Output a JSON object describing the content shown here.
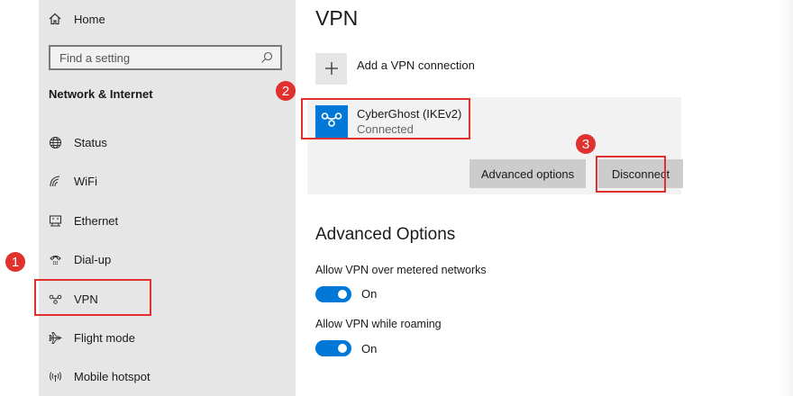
{
  "sidebar": {
    "home_label": "Home",
    "search_placeholder": "Find a setting",
    "section_title": "Network & Internet",
    "items": [
      {
        "label": "Status",
        "icon": "globe-icon"
      },
      {
        "label": "WiFi",
        "icon": "wifi-icon"
      },
      {
        "label": "Ethernet",
        "icon": "ethernet-icon"
      },
      {
        "label": "Dial-up",
        "icon": "dialup-icon"
      },
      {
        "label": "VPN",
        "icon": "vpn-icon"
      },
      {
        "label": "Flight mode",
        "icon": "airplane-icon"
      },
      {
        "label": "Mobile hotspot",
        "icon": "hotspot-icon"
      }
    ]
  },
  "main": {
    "title": "VPN",
    "add_vpn_label": "Add a VPN connection",
    "connection": {
      "name": "CyberGhost (IKEv2)",
      "status": "Connected",
      "advanced_button": "Advanced options",
      "disconnect_button": "Disconnect"
    },
    "advanced_title": "Advanced Options",
    "options": [
      {
        "label": "Allow VPN over metered networks",
        "state": "On",
        "enabled": true
      },
      {
        "label": "Allow VPN while roaming",
        "state": "On",
        "enabled": true
      }
    ]
  },
  "annotations": [
    "1",
    "2",
    "3"
  ],
  "colors": {
    "accent": "#0078d7",
    "highlight": "#e0312e",
    "sidebar_bg": "#e6e6e6"
  }
}
